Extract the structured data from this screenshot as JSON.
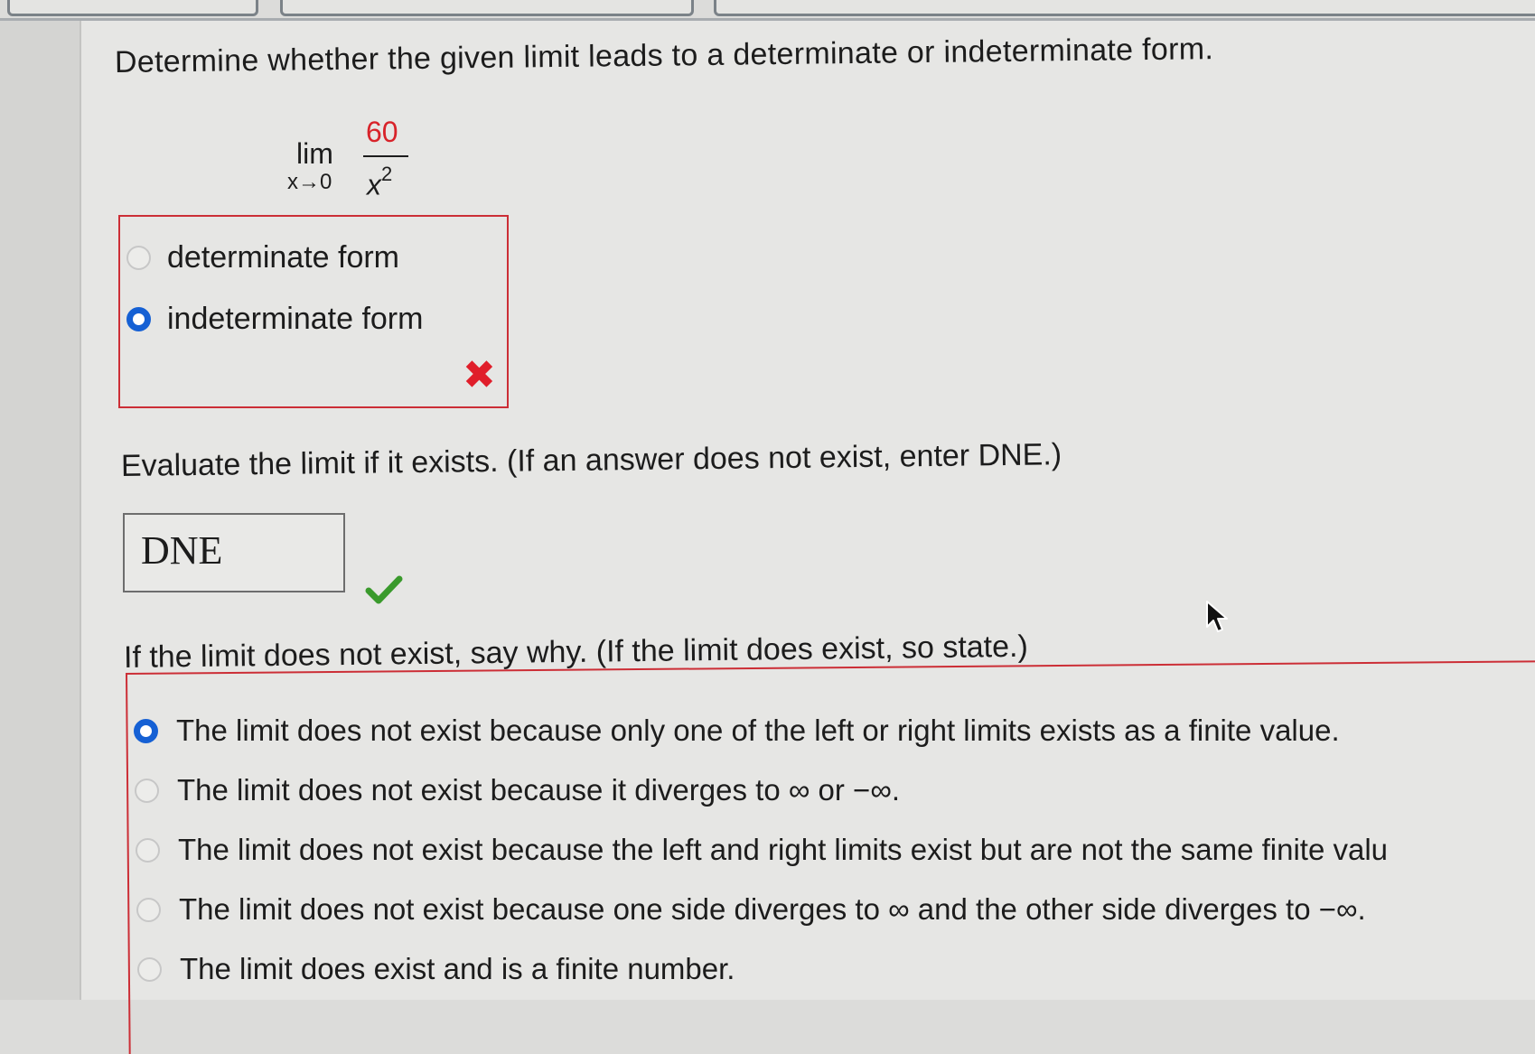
{
  "question": {
    "text": "Determine whether the given limit leads to a determinate or indeterminate form.",
    "limit": {
      "operator": "lim",
      "subscript": "x→0",
      "numerator": "60",
      "denominator_base": "x",
      "denominator_exponent": "2"
    },
    "form_options": [
      {
        "label": "determinate form",
        "selected": false
      },
      {
        "label": "indeterminate form",
        "selected": true
      }
    ],
    "form_result": "incorrect"
  },
  "evaluate": {
    "prompt": "Evaluate the limit if it exists. (If an answer does not exist, enter DNE.)",
    "answer": "DNE",
    "result": "correct"
  },
  "reason": {
    "prompt": "If the limit does not exist, say why. (If the limit does exist, so state.)",
    "options": [
      {
        "label": "The limit does not exist because only one of the left or right limits exists as a finite value.",
        "selected": true
      },
      {
        "label": "The limit does not exist because it diverges to ∞ or −∞.",
        "selected": false
      },
      {
        "label": "The limit does not exist because the left and right limits exist but are not the same finite valu",
        "selected": false
      },
      {
        "label": "The limit does not exist because one side diverges to ∞ and the other side diverges to −∞.",
        "selected": false
      },
      {
        "label": "The limit does exist and is a finite number.",
        "selected": false
      }
    ]
  },
  "colors": {
    "accent_blue": "#1560d4",
    "error_red": "#cc2e36",
    "correct_green": "#3a9a2c"
  },
  "icons": {
    "wrong_mark": "close-icon",
    "right_mark": "checkmark-icon",
    "pointer": "cursor-icon"
  }
}
